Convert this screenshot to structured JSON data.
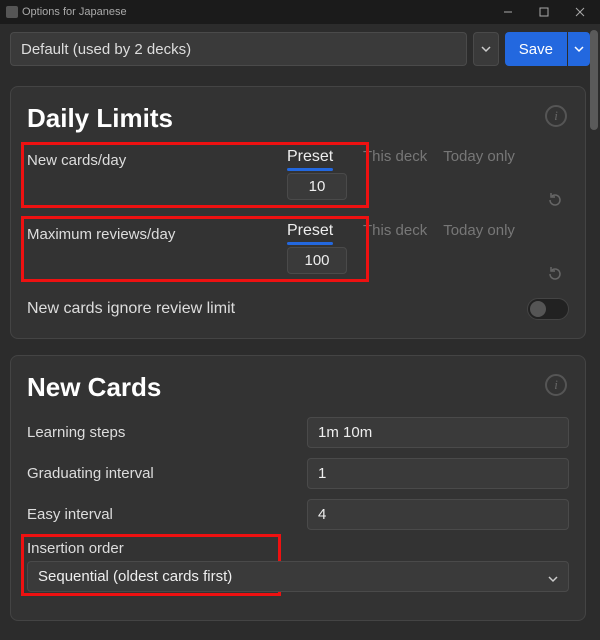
{
  "window": {
    "title": "Options for Japanese"
  },
  "toprow": {
    "preset_label": "Default (used by 2 decks)",
    "save_label": "Save"
  },
  "daily": {
    "heading": "Daily Limits",
    "new_cards": {
      "label": "New cards/day",
      "tabs": {
        "preset": "Preset",
        "deck": "This deck",
        "today": "Today only"
      },
      "value": "10"
    },
    "max_reviews": {
      "label": "Maximum reviews/day",
      "tabs": {
        "preset": "Preset",
        "deck": "This deck",
        "today": "Today only"
      },
      "value": "100"
    },
    "ignore_label": "New cards ignore review limit"
  },
  "newcards": {
    "heading": "New Cards",
    "learning_steps": {
      "label": "Learning steps",
      "value": "1m 10m"
    },
    "graduating": {
      "label": "Graduating interval",
      "value": "1"
    },
    "easy": {
      "label": "Easy interval",
      "value": "4"
    },
    "insertion": {
      "label": "Insertion order",
      "value": "Sequential (oldest cards first)"
    }
  }
}
